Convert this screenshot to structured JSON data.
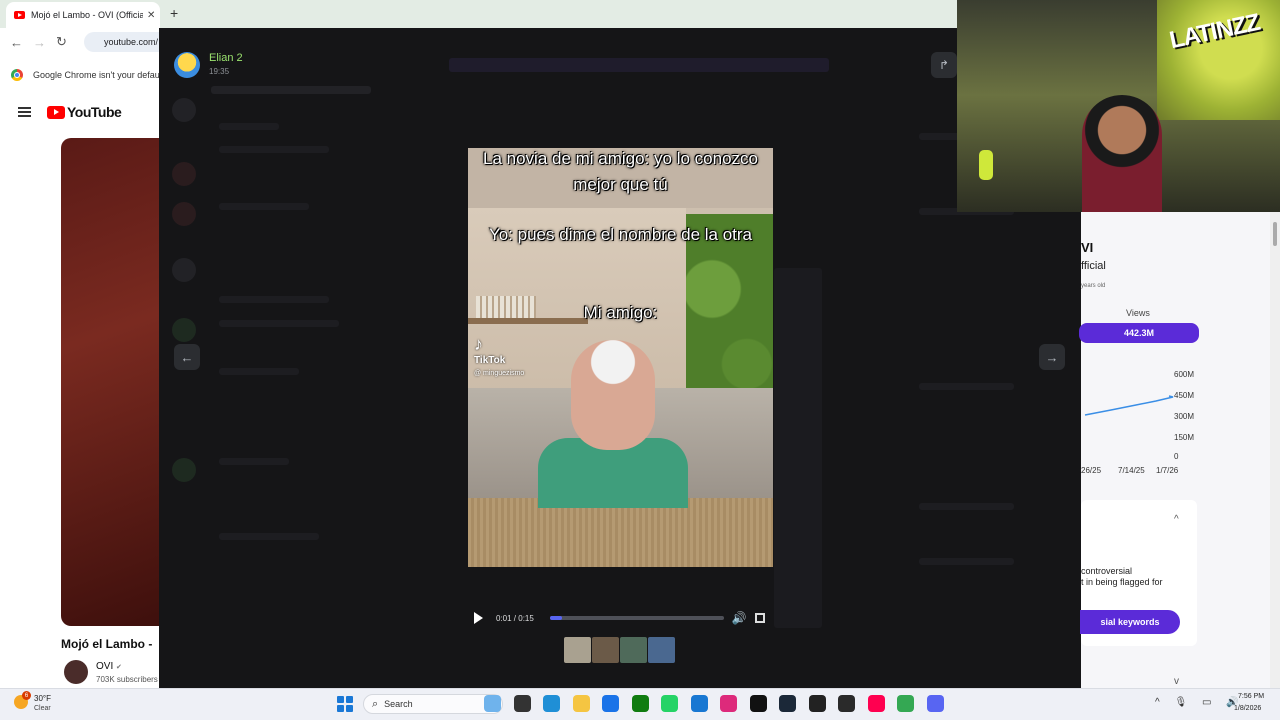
{
  "browser": {
    "tab_title": "Mojó el Lambo - OVI (Official V",
    "tab_close": "✕",
    "new_tab": "+",
    "back": "←",
    "forward": "→",
    "reload": "↻",
    "url": "youtube.com/",
    "infobar_text": "Google Chrome isn't your defau"
  },
  "youtube": {
    "logo_text": "YouTube",
    "video_title": "Mojó el Lambo -",
    "channel_name": "OVI",
    "verified": "✔",
    "subscribers": "703K subscribers"
  },
  "viewer": {
    "poster_name": "Elian 2",
    "poster_time": "19:35",
    "share_icon": "↱",
    "prev_icon": "←",
    "next_icon": "→",
    "captions": [
      "La novia de mi amigo: yo lo conozco mejor que tú",
      "Yo: pues dime el nombre de la otra",
      "Mi amigo:"
    ],
    "watermark_app": "TikTok",
    "watermark_note": "♪",
    "watermark_handle": "@ minguezismo",
    "timecode": "0:01 / 0:15",
    "progress": 0.07,
    "volume_icon": "🔊",
    "thumbnail_colors": [
      "#a9a190",
      "#6b5a48",
      "#4f6a5a",
      "#4a6890"
    ]
  },
  "stats_panel": {
    "name": "VI",
    "official": "fficial",
    "age": "years old",
    "views_label": "Views",
    "views_value": "442.3M",
    "chart_y_ticks": [
      "600M",
      "450M",
      "300M",
      "150M",
      "0"
    ],
    "chart_x_ticks": [
      "26/25",
      "7/14/25",
      "1/7/26"
    ],
    "controversial_line1": "controversial",
    "controversial_line2": "t in being flagged for",
    "keywords_button": "sial keywords",
    "chevron_up": "^",
    "chevron_down": "v"
  },
  "webcam": {
    "graffiti": "LATINZZ"
  },
  "taskbar": {
    "weather_badge": "6",
    "temperature": "30°F",
    "condition": "Clear",
    "search_label": "Search",
    "search_icon": "⌕",
    "tray": "^ 🎙 ▭ 🔊",
    "time": "7:56 PM",
    "date": "1/8/2026",
    "app_icons": [
      "#6fb3ec",
      "#333333",
      "#1f8fd6",
      "#f5c542",
      "#1a73e8",
      "#107c10",
      "#25d366",
      "#1877d2",
      "#dd2a7b",
      "#111111",
      "#1b2838",
      "#222222",
      "#2a2a2a",
      "#ff0050",
      "#34a853",
      "#5865f2"
    ]
  },
  "colors": {
    "overlay_bg": "#151517",
    "accent": "#5865f2",
    "purple": "#5b2bd8",
    "name_green": "#9be36f"
  }
}
